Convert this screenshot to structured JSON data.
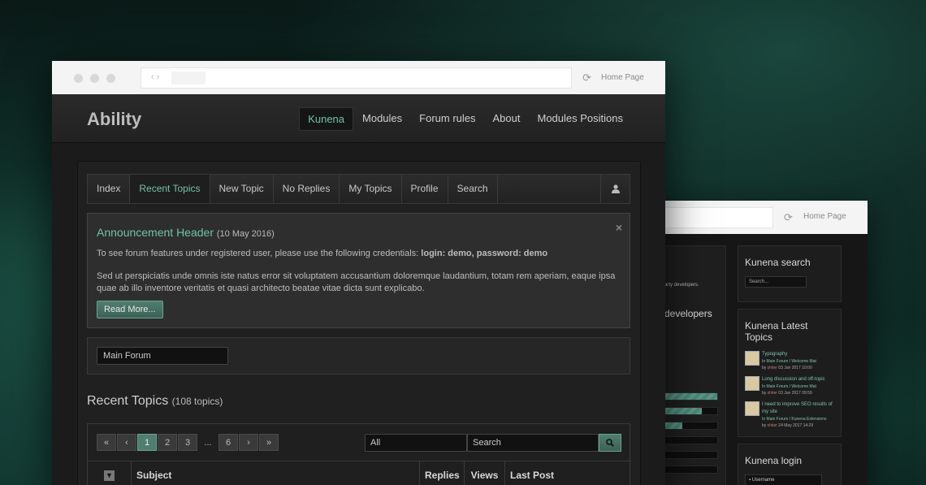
{
  "browser": {
    "home_label": "Home Page",
    "reload_icon": "reload-icon"
  },
  "site": {
    "logo": "Ability",
    "nav": [
      "Kunena",
      "Modules",
      "Forum rules",
      "About",
      "Modules Positions"
    ],
    "active_nav": "Kunena"
  },
  "forum_nav": {
    "items": [
      "Index",
      "Recent Topics",
      "New Topic",
      "No Replies",
      "My Topics",
      "Profile",
      "Search"
    ],
    "active": "Recent Topics",
    "user_icon": "user-icon"
  },
  "announcement": {
    "title": "Announcement Header",
    "date": "(10 May 2016)",
    "line1_prefix": "To see forum features under registered user, please use the following credentials:",
    "line1_bold": "login: demo, password: demo",
    "body": "Sed ut perspiciatis unde omnis iste natus error sit voluptatem accusantium doloremque laudantium, totam rem aperiam, eaque ipsa quae ab illo inventore veritatis et quasi architecto beatae vitae dicta sunt explicabo.",
    "read_more": "Read More...",
    "close": "×"
  },
  "category_select": {
    "value": "Main Forum"
  },
  "recent_topics": {
    "title": "Recent Topics",
    "count": "(108 topics)",
    "pager": [
      "«",
      "‹",
      "1",
      "2",
      "3",
      "...",
      "6",
      "›",
      "»"
    ],
    "current_page": "1",
    "filter_value": "All",
    "search_placeholder": "Search",
    "columns": [
      "Subject",
      "Replies",
      "Views",
      "Last Post"
    ]
  },
  "back_window": {
    "home_label": "Home Page",
    "snippet1": "arty developers.",
    "snippet2": "developers",
    "bar_levels": [
      1.0,
      0.7,
      0.33,
      0,
      0,
      0
    ],
    "search_module": {
      "title": "Kunena search",
      "placeholder": "Search..."
    },
    "latest_module": {
      "title": "Kunena Latest Topics",
      "topics": [
        {
          "title": "Typography",
          "where": "In Main Forum / Welcome Mat",
          "by": "shtier",
          "date": "03 Jun 2017 10:00"
        },
        {
          "title": "Long discussion and off-topic",
          "where": "In Main Forum / Welcome Mat",
          "by": "shtier",
          "date": "03 Jun 2017 09:59"
        },
        {
          "title": "I need to improve SEO results of my site",
          "where": "In Main Forum / Kunena Extensions",
          "by": "shtier",
          "date": "24 May 2017 14:29"
        }
      ]
    },
    "login_module": {
      "title": "Kunena login",
      "username_placeholder": "Username"
    }
  }
}
